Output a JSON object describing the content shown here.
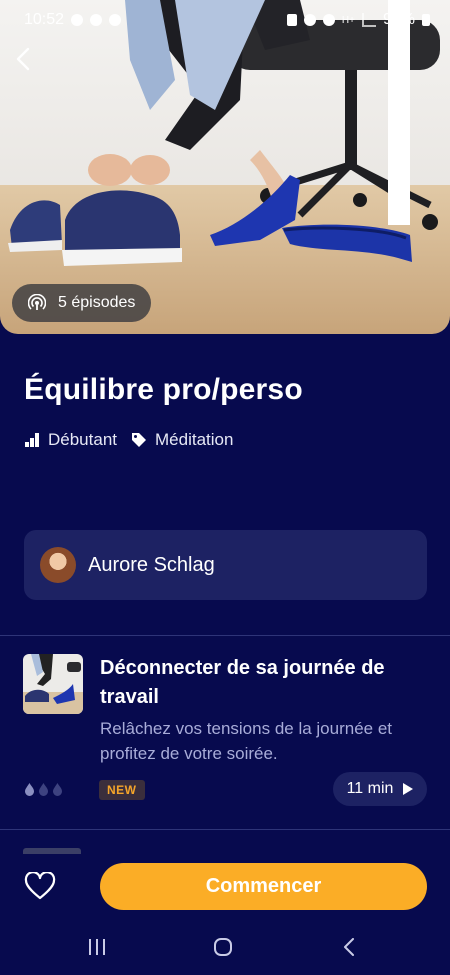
{
  "status_bar": {
    "time": "10:52",
    "battery": "94%",
    "network": "H+"
  },
  "hero": {
    "image": "office-shoes-photo",
    "episodes_label": "5 épisodes",
    "back_icon": "chevron-left-icon",
    "podcast_icon": "podcast-icon"
  },
  "program": {
    "title": "Équilibre pro/perso",
    "level": "Débutant",
    "category": "Méditation",
    "level_icon": "signal-bars-icon",
    "category_icon": "tag-icon"
  },
  "author": {
    "name": "Aurore Schlag"
  },
  "episodes": [
    {
      "title": "Déconnecter de sa journée de travail",
      "description": "Relâchez vos tensions de la journée et profitez de votre soirée.",
      "badge": "NEW",
      "duration": "11 min",
      "difficulty_level": 1,
      "difficulty_max": 3
    }
  ],
  "actions": {
    "start_label": "Commencer",
    "favorite_icon": "heart-outline-icon"
  },
  "colors": {
    "background": "#070a4e",
    "card": "#1d2263",
    "accent": "#fbad26",
    "badge_text": "#f5a52a"
  }
}
